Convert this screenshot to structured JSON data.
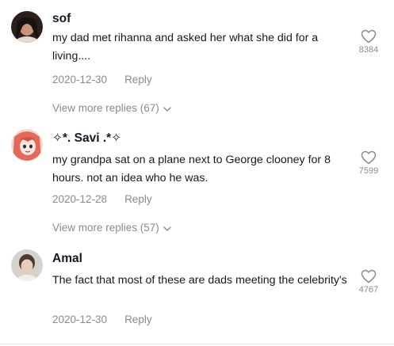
{
  "comments": [
    {
      "username": "sof",
      "text": "my dad met rihanna and asked her what she did for a living....",
      "date": "2020-12-30",
      "reply_label": "Reply",
      "likes": "8384",
      "view_more": "View more replies (67)"
    },
    {
      "username": "✧*. Savi .*✧",
      "text": "my grandpa sat on a plane next to George clooney for 8 hours. not an idea who he was.",
      "date": "2020-12-28",
      "reply_label": "Reply",
      "likes": "7599",
      "view_more": "View more replies (57)"
    },
    {
      "username": "Amal",
      "text": "The fact that most of these are dads meeting the celebrity's",
      "date": "2020-12-30",
      "reply_label": "Reply",
      "likes": "4767"
    }
  ],
  "icons": {
    "like": "heart-outline-icon",
    "expand": "chevron-down-icon"
  },
  "colors": {
    "text": "#161823",
    "muted": "#8a8b91",
    "divider": "#e3e3e4"
  }
}
